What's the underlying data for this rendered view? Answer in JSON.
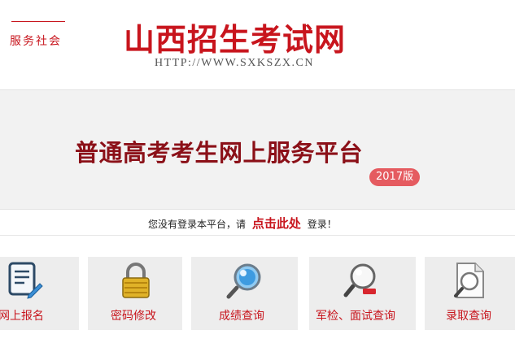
{
  "header": {
    "slogan": "服务社会",
    "site_title": "山西招生考试网",
    "site_url": "HTTP://WWW.SXKSZX.CN"
  },
  "banner": {
    "title": "普通高考考生网上服务平台",
    "version": "2017版"
  },
  "login": {
    "prefix": "您没有登录本平台，请",
    "link": "点击此处",
    "suffix": "登录！"
  },
  "services": [
    {
      "label": "网上报名",
      "icon": "edit-document-icon"
    },
    {
      "label": "密码修改",
      "icon": "padlock-icon"
    },
    {
      "label": "成绩查询",
      "icon": "magnifier-icon"
    },
    {
      "label": "军检、面试查询",
      "icon": "magnifier-minus-icon"
    },
    {
      "label": "录取查询",
      "icon": "document-search-icon"
    }
  ],
  "colors": {
    "brand_red": "#c8151d",
    "title_dark_red": "#8b1018",
    "badge": "#e55b60",
    "banner_bg": "#f2f2f2",
    "card_bg": "#ededed"
  }
}
